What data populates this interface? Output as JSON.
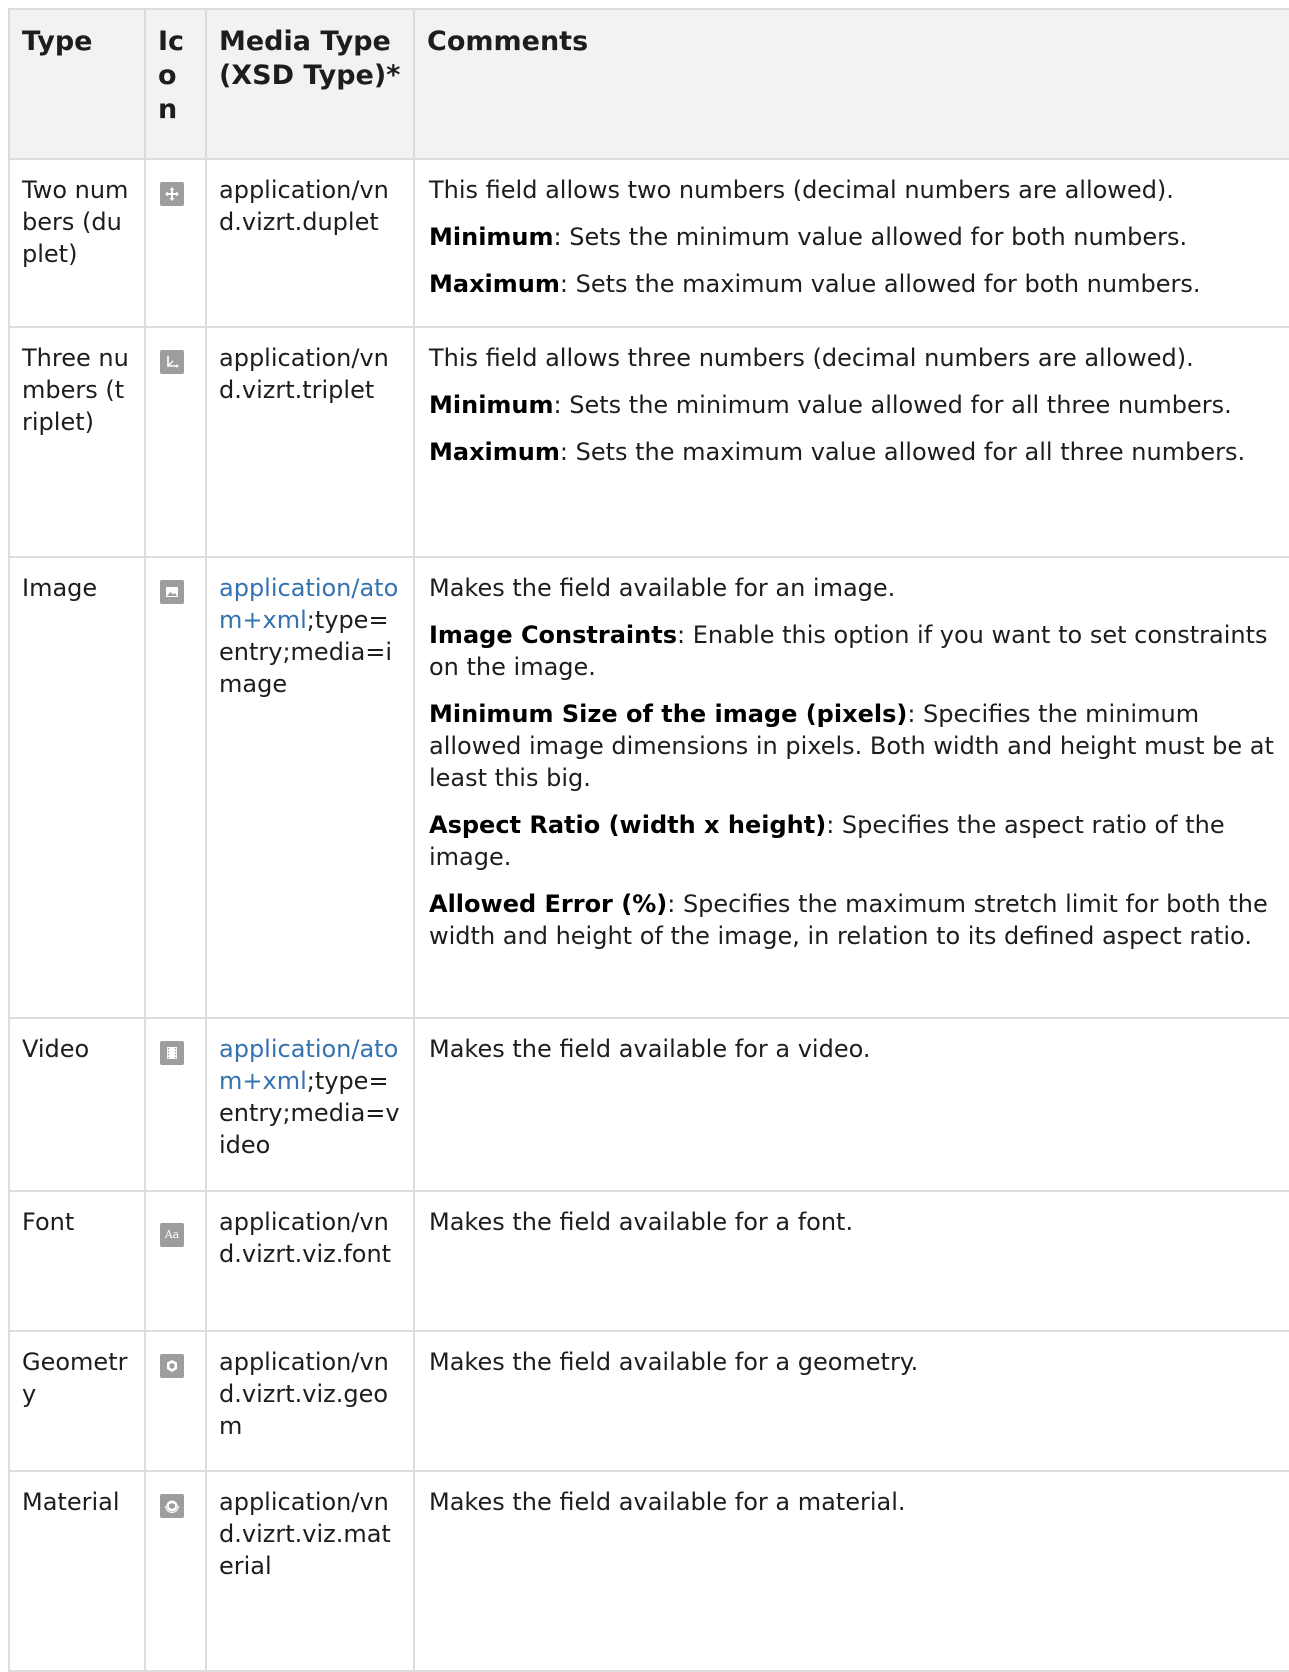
{
  "header": {
    "type": "Type",
    "icon": "Icon",
    "media_type": "Media Type (XSD Type)*",
    "comments": "Comments"
  },
  "rows": [
    {
      "type": "Two numbers (duplet)",
      "icon": "move-arrows-icon",
      "media": "application/vnd.vizrt.duplet",
      "comments": [
        {
          "text": "This field allows two numbers (decimal numbers are allowed)."
        },
        {
          "bold": "Minimum",
          "text": ": Sets the minimum value allowed for both numbers."
        },
        {
          "bold": "Maximum",
          "text": ": Sets the maximum value allowed for both numbers."
        }
      ]
    },
    {
      "type": "Three numbers (triplet)",
      "icon": "axes-icon",
      "media": "application/vnd.vizrt.triplet",
      "comments": [
        {
          "text": "This field allows three numbers (decimal numbers are allowed)."
        },
        {
          "bold": "Minimum",
          "text": ": Sets the minimum value allowed for all three numbers."
        },
        {
          "bold": "Maximum",
          "text": ": Sets the maximum value allowed for all three numbers."
        }
      ]
    },
    {
      "type": "Image",
      "icon": "image-icon",
      "media_link": "application/atom+xml",
      "media_rest": ";type=entry;media=image",
      "comments": [
        {
          "text": "Makes the field available for an image."
        },
        {
          "bold": "Image Constraints",
          "text": ": Enable this option if you want to set constraints on the image."
        },
        {
          "bold": "Minimum Size of the image (pixels)",
          "text": ": Specifies the minimum allowed image dimensions in pixels. Both width and height must be at least this big."
        },
        {
          "bold": "Aspect Ratio (width x height)",
          "text": ": Specifies the aspect ratio of the image."
        },
        {
          "bold": "Allowed Error (%)",
          "text": ": Specifies the maximum stretch limit for both the width and height of the image, in relation to its defined aspect ratio."
        }
      ]
    },
    {
      "type": "Video",
      "icon": "film-icon",
      "media_link": "application/atom+xml",
      "media_rest": ";type=entry;media=video",
      "comments": [
        {
          "text": "Makes the field available for a video."
        }
      ]
    },
    {
      "type": "Font",
      "icon": "font-icon",
      "icon_text": "Aa",
      "media": "application/vnd.vizrt.viz.font",
      "comments": [
        {
          "text": "Makes the field available for a font."
        }
      ]
    },
    {
      "type": "Geometry",
      "icon": "geometry-icon",
      "media": "application/vnd.vizrt.viz.geom",
      "comments": [
        {
          "text": "Makes the field available for a geometry."
        }
      ]
    },
    {
      "type": "Material",
      "icon": "material-icon",
      "media": "application/vnd.vizrt.viz.material",
      "comments": [
        {
          "text": "Makes the field available for a material."
        }
      ]
    }
  ]
}
